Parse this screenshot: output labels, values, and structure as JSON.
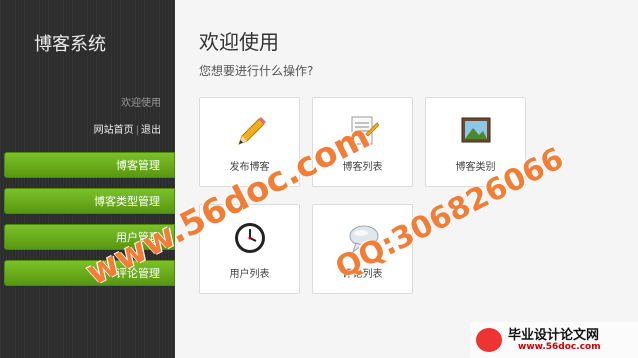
{
  "sidebar": {
    "brand": "博客系统",
    "welcome": "欢迎使用",
    "home_link": "网站首页",
    "separator": "|",
    "logout_link": "退出",
    "items": [
      {
        "label": "博客管理"
      },
      {
        "label": "博客类型管理"
      },
      {
        "label": "用户管理"
      },
      {
        "label": "评论管理"
      }
    ]
  },
  "main": {
    "title": "欢迎使用",
    "subtitle": "您想要进行什么操作?",
    "tiles": [
      {
        "label": "发布博客",
        "icon": "pencil-icon"
      },
      {
        "label": "博客列表",
        "icon": "document-icon"
      },
      {
        "label": "博客类别",
        "icon": "picture-icon"
      },
      {
        "label": "用户列表",
        "icon": "clock-icon"
      },
      {
        "label": "评论列表",
        "icon": "speech-bubble-icon"
      }
    ]
  },
  "watermark": {
    "site": "www.56doc.com",
    "qq": "QQ:306826066",
    "stamp_title": "毕业设计论文网",
    "stamp_url": "www.56doc.com"
  },
  "colors": {
    "accent": "#6aad1c",
    "watermark": "#ee6614"
  }
}
